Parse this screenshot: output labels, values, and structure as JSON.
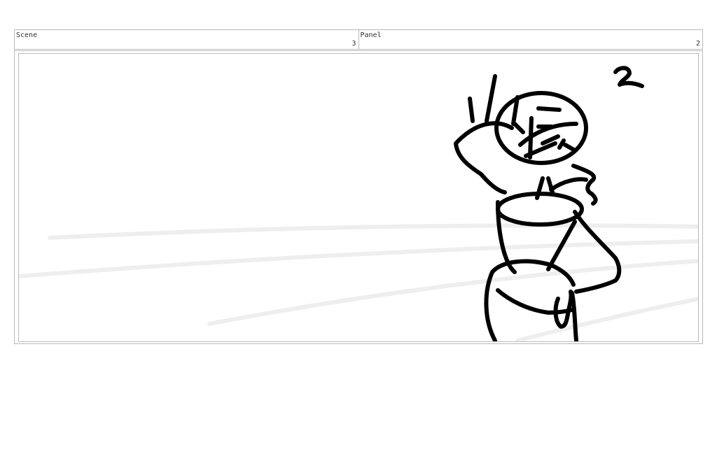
{
  "header": {
    "scene_label": "Scene",
    "scene_number": "3",
    "panel_label": "Panel",
    "panel_number": "2"
  },
  "drawing": {
    "ink_color": "#000000",
    "speed_line_color": "#eeeeee",
    "frame_border_color": "#b9b9b9"
  }
}
